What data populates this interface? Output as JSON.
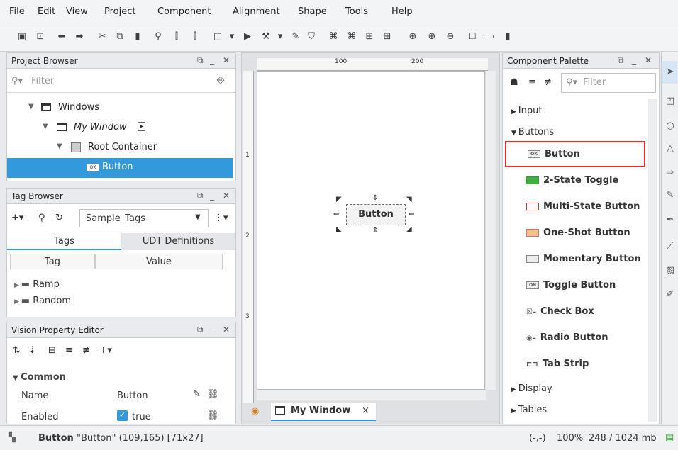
{
  "menu": [
    "File",
    "Edit",
    "View",
    "Project",
    "Component",
    "Alignment",
    "Shape",
    "Tools",
    "Help"
  ],
  "project_browser": {
    "title": "Project Browser",
    "filter_placeholder": "Filter",
    "tree": [
      {
        "label": "Windows"
      },
      {
        "label": "My Window"
      },
      {
        "label": "Root Container"
      },
      {
        "label": "Button"
      }
    ]
  },
  "tag_browser": {
    "title": "Tag Browser",
    "provider": "Sample_Tags",
    "tabs": [
      "Tags",
      "UDT Definitions"
    ],
    "columns": [
      "Tag",
      "Value"
    ],
    "rows": [
      "Ramp",
      "Random"
    ]
  },
  "property_editor": {
    "title": "Vision Property Editor",
    "section": "Common",
    "rows": [
      {
        "name": "Name",
        "value": "Button"
      },
      {
        "name": "Enabled",
        "value": "true"
      }
    ]
  },
  "canvas": {
    "ruler_top": [
      "100",
      "200"
    ],
    "ruler_left": [
      "1",
      "2",
      "3"
    ],
    "button_label": "Button",
    "tab": "My Window"
  },
  "palette": {
    "title": "Component Palette",
    "filter_placeholder": "Filter",
    "categories": {
      "input": "Input",
      "buttons": "Buttons",
      "display": "Display",
      "tables": "Tables"
    },
    "items": [
      "Button",
      "2-State Toggle",
      "Multi-State Button",
      "One-Shot Button",
      "Momentary Button",
      "Toggle Button",
      "Check Box",
      "Radio Button",
      "Tab Strip"
    ],
    "icons": {
      "button": "OK",
      "toggle": "ON"
    }
  },
  "status": {
    "name_bold": "Button",
    "detail": "\"Button\" (109,165) [71x27]",
    "coords": "(-,-)",
    "zoom": "100%",
    "memory": "248 / 1024 mb"
  },
  "colors": {
    "selection": "#3399dd",
    "highlight_border": "#e03030"
  }
}
